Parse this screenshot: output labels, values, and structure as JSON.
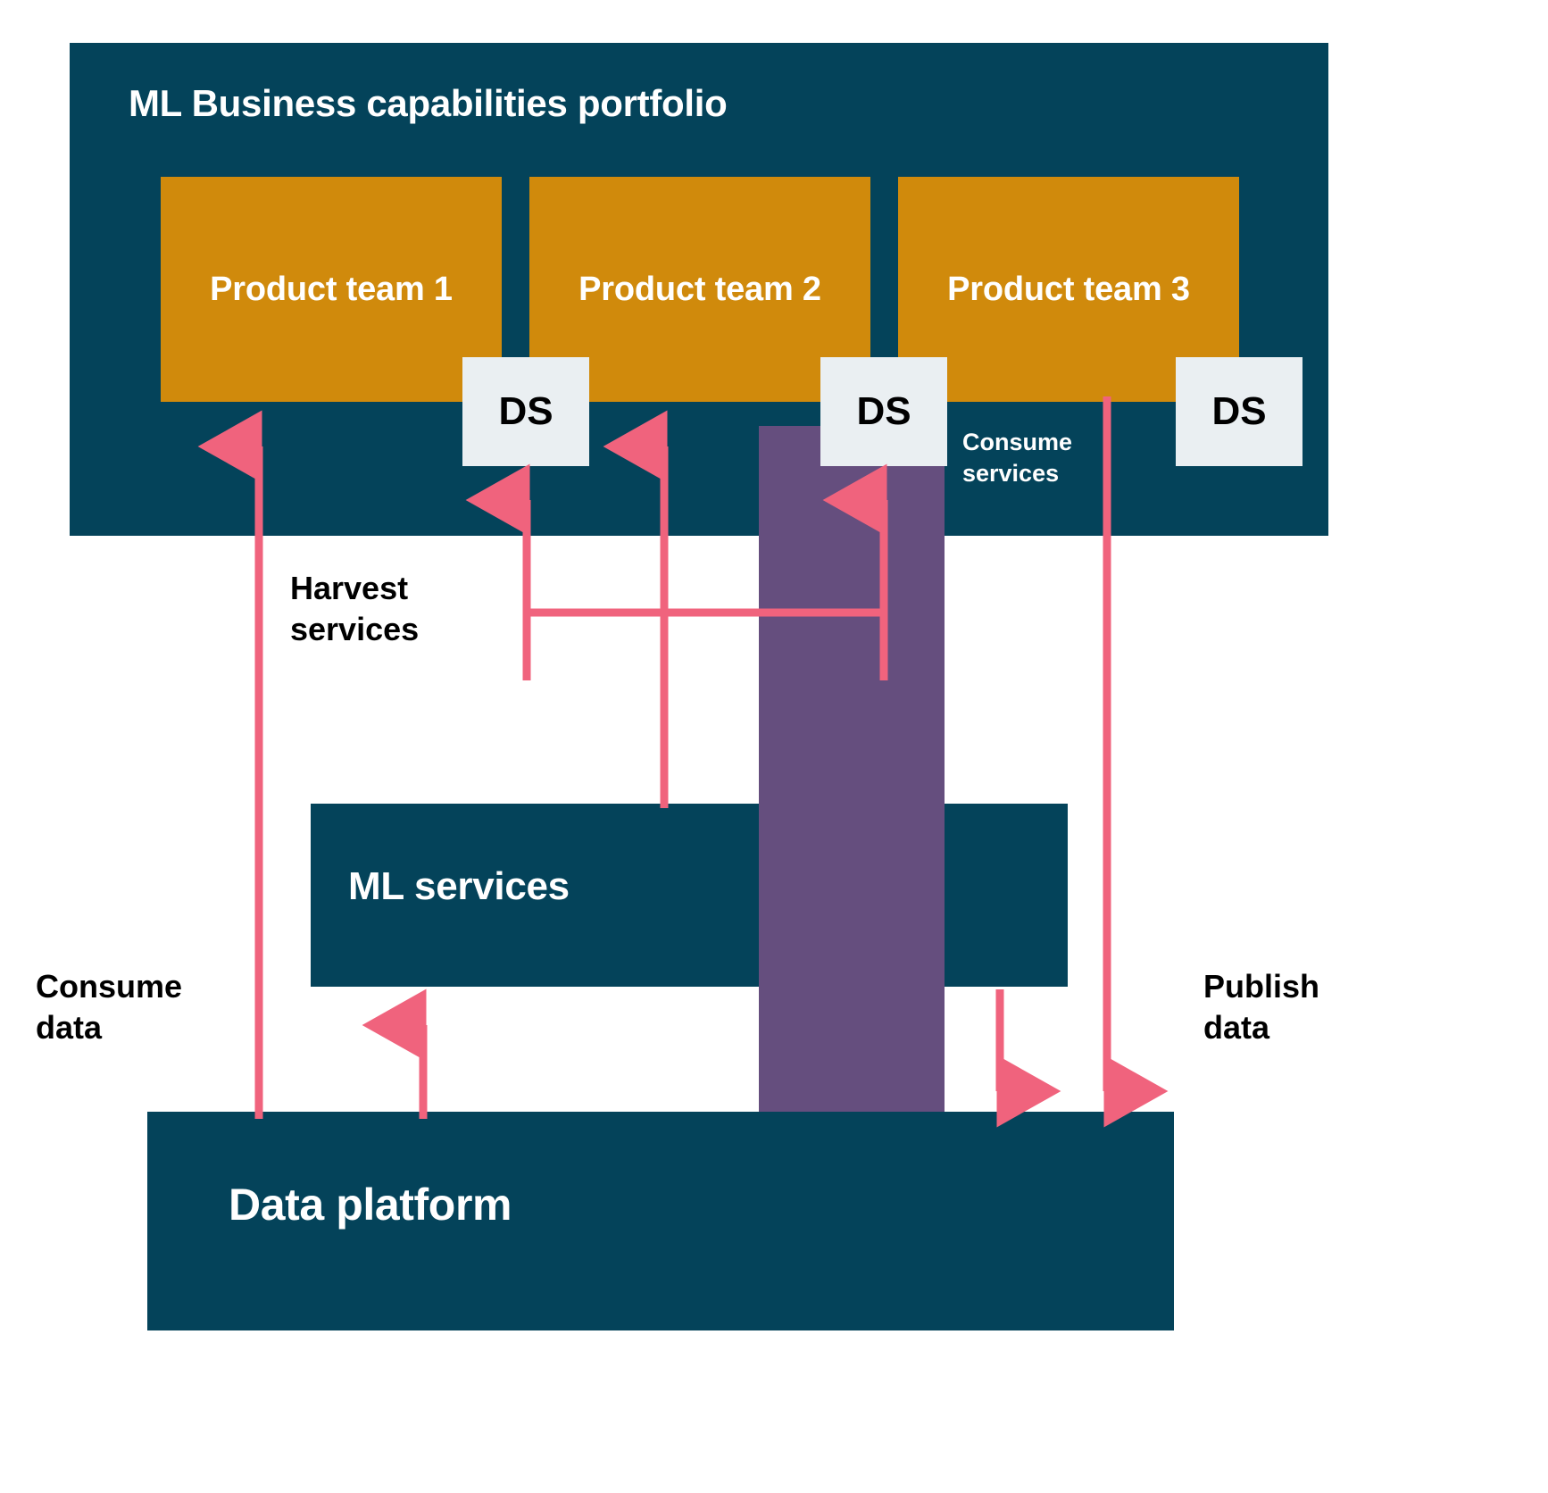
{
  "colors": {
    "teal": "#04435a",
    "orange": "#d08a0c",
    "purple": "#654e7e",
    "pink": "#f0637d",
    "ds_bg": "#eaeff2",
    "white": "#ffffff",
    "black": "#000000"
  },
  "portfolio": {
    "title": "ML Business capabilities portfolio",
    "teams": [
      {
        "label": "Product team 1"
      },
      {
        "label": "Product team 2"
      },
      {
        "label": "Product team 3"
      }
    ],
    "ds_boxes": [
      {
        "label": "DS"
      },
      {
        "label": "DS"
      },
      {
        "label": "DS"
      }
    ],
    "consume_services_label": "Consume\nservices"
  },
  "platform": {
    "ml_services_label": "ML services",
    "data_platform_label": "Data platform"
  },
  "annotations": {
    "harvest_services": "Harvest\nservices",
    "consume_data": "Consume\ndata",
    "publish_data": "Publish\ndata"
  },
  "chart_data": {
    "type": "diagram",
    "title": "ML Business capabilities portfolio",
    "nodes": [
      {
        "id": "portfolio",
        "label": "ML Business capabilities portfolio",
        "kind": "container",
        "color": "#04435a"
      },
      {
        "id": "team1",
        "label": "Product team 1",
        "kind": "box",
        "color": "#d08a0c"
      },
      {
        "id": "team2",
        "label": "Product team 2",
        "kind": "box",
        "color": "#d08a0c"
      },
      {
        "id": "team3",
        "label": "Product team 3",
        "kind": "box",
        "color": "#d08a0c"
      },
      {
        "id": "ds1",
        "label": "DS",
        "kind": "square",
        "color": "#eaeff2"
      },
      {
        "id": "ds2",
        "label": "DS",
        "kind": "square",
        "color": "#eaeff2"
      },
      {
        "id": "ds3",
        "label": "DS",
        "kind": "square",
        "color": "#eaeff2"
      },
      {
        "id": "ml_services",
        "label": "ML services",
        "kind": "box",
        "color": "#04435a"
      },
      {
        "id": "data_platform",
        "label": "Data platform",
        "kind": "box",
        "color": "#04435a"
      },
      {
        "id": "purple_column",
        "label": "",
        "kind": "column",
        "color": "#654e7e"
      }
    ],
    "edges": [
      {
        "from": "data_platform",
        "to": "team1",
        "label": "Consume data",
        "direction": "up",
        "color": "#f0637d"
      },
      {
        "from": "data_platform",
        "to": "ml_services",
        "label": "",
        "direction": "up",
        "color": "#f0637d"
      },
      {
        "from": "ml_services",
        "to": "ds1",
        "label": "Harvest services",
        "direction": "up",
        "color": "#f0637d"
      },
      {
        "from": "ml_services",
        "to": "team2",
        "label": "Harvest services",
        "direction": "up",
        "color": "#f0637d"
      },
      {
        "from": "ml_services",
        "to": "ds2",
        "label": "Harvest services",
        "direction": "up",
        "color": "#f0637d"
      },
      {
        "from": "ml_services",
        "to": "data_platform",
        "label": "",
        "direction": "down",
        "color": "#f0637d"
      },
      {
        "from": "ds3",
        "to": "data_platform",
        "label": "Publish data",
        "direction": "down",
        "color": "#f0637d"
      }
    ]
  }
}
